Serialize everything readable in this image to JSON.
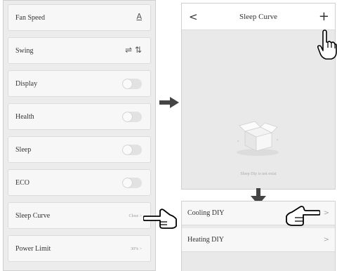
{
  "settings": {
    "rows": [
      {
        "label": "Fan Speed",
        "kind": "icon",
        "icon": "fan-speed-icon",
        "glyph": "A"
      },
      {
        "label": "Swing",
        "kind": "icon",
        "icon": "swing-icon",
        "glyph": "⇌ ⇅"
      },
      {
        "label": "Display",
        "kind": "toggle",
        "state": "off"
      },
      {
        "label": "Health",
        "kind": "toggle",
        "state": "off"
      },
      {
        "label": "Sleep",
        "kind": "toggle",
        "state": "off"
      },
      {
        "label": "ECO",
        "kind": "toggle",
        "state": "off"
      },
      {
        "label": "Sleep Curve",
        "kind": "value",
        "value": "Close >"
      },
      {
        "label": "Power Limit",
        "kind": "value",
        "value": "30% >"
      }
    ]
  },
  "sleep_curve": {
    "back_glyph": "<",
    "title": "Sleep Curve",
    "add_glyph": "+",
    "empty_text": "Sleep Diy is not exist"
  },
  "diy_list": {
    "items": [
      {
        "label": "Cooling DIY",
        "chevron": ">"
      },
      {
        "label": "Heating DIY",
        "chevron": ">"
      }
    ]
  },
  "colors": {
    "panel_bg": "#ececec",
    "row_bg": "#f7f7f7",
    "arrow": "#444444"
  }
}
